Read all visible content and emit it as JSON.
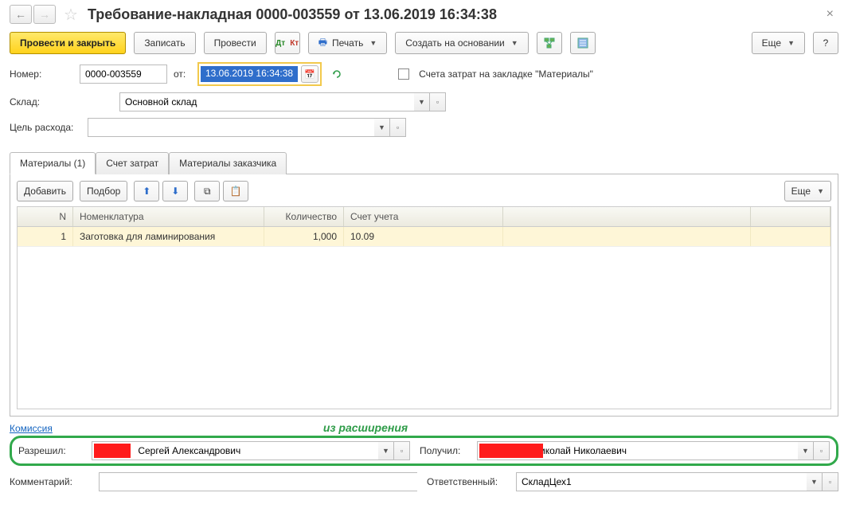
{
  "title": "Требование-накладная 0000-003559 от 13.06.2019 16:34:38",
  "toolbar": {
    "post_and_close": "Провести и закрыть",
    "save": "Записать",
    "post": "Провести",
    "print": "Печать",
    "create_by": "Создать на основании",
    "more": "Еще"
  },
  "form": {
    "number_label": "Номер:",
    "number": "0000-003559",
    "from_label": "от:",
    "date": "13.06.2019 16:34:38",
    "cost_accounts_checkbox": "Счета затрат на закладке \"Материалы\"",
    "warehouse_label": "Склад:",
    "warehouse": "Основной склад",
    "purpose_label": "Цель расхода:",
    "purpose": ""
  },
  "tabs": {
    "materials": "Материалы (1)",
    "cost_account": "Счет затрат",
    "customer_materials": "Материалы заказчика"
  },
  "subtoolbar": {
    "add": "Добавить",
    "pick": "Подбор",
    "more": "Еще"
  },
  "grid": {
    "headers": {
      "n": "N",
      "nomen": "Номенклатура",
      "qty": "Количество",
      "acct": "Счет учета"
    },
    "rows": [
      {
        "n": "1",
        "nomen": "Заготовка для ламинирования",
        "qty": "1,000",
        "acct": "10.09"
      }
    ]
  },
  "bottom": {
    "commission": "Комиссия",
    "ext_note": "из расширения",
    "approved_label": "Разрешил:",
    "approved_name": " Сергей Александрович",
    "received_label": "Получил:",
    "received_name": " Николай Николаевич",
    "comment_label": "Комментарий:",
    "comment": "",
    "responsible_label": "Ответственный:",
    "responsible": "СкладЦех1"
  }
}
